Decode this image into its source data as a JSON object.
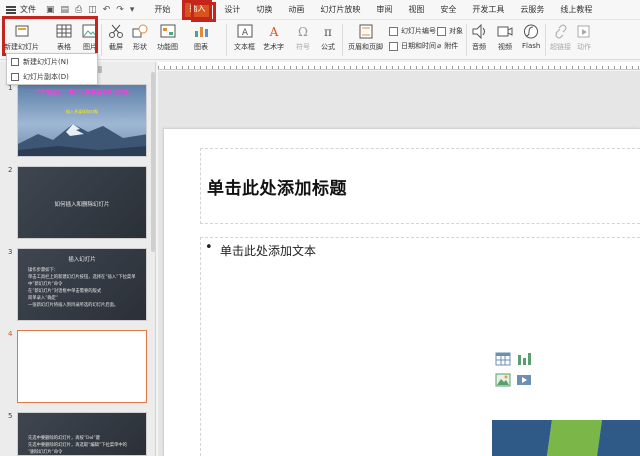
{
  "menubar": {
    "file_label": "文件",
    "menus": [
      "开始",
      "插入",
      "设计",
      "切换",
      "动画",
      "幻灯片放映",
      "审阅",
      "视图",
      "安全",
      "开发工具",
      "云服务",
      "线上教程"
    ],
    "active_menu": "插入"
  },
  "ribbon": {
    "new_slide": "新建幻灯片",
    "table": "表格",
    "picture": "图片",
    "screenshot": "截屏",
    "shape": "形状",
    "function_chart": "功能图",
    "chart": "图表",
    "textbox": "文本框",
    "wordart": "艺术字",
    "symbol": "符号",
    "formula": "公式",
    "header_footer": "页眉和页脚",
    "slide_number": "幻灯片编号",
    "date_time": "日期和时间",
    "object": "对象",
    "attachment": "附件",
    "audio": "音频",
    "video": "视频",
    "flash": "Flash",
    "hyperlink": "超链接",
    "action": "动作"
  },
  "dropdown": {
    "items": [
      "新建幻灯片(N)",
      "幻灯片副本(D)"
    ]
  },
  "thumbnails": {
    "slide1_title": "汽车制造行一事业天赛事活动转化比赔",
    "slide1_sub": "插入多媒体和对象",
    "slide2_title": "如何插入和删除幻灯片",
    "slide3_title": "插入幻灯片",
    "slide3_lines": [
      "操作步骤如下：",
      "单击工具栏上的新建幻灯片按钮，选择在“插入”下拉菜单",
      "中“新幻灯片”命令",
      "在“新幻灯片”对话框中单击需要的版式",
      "简单录入“确定”",
      "一张新幻灯片将插入到目录所选的幻灯片后面。"
    ],
    "slide5_lines": [
      "先选中要删除的幻灯片，再按“Del”键",
      "先选中要删除的幻灯片，再选取“编辑”下拉菜单中的",
      "“删除幻灯片”命令"
    ],
    "numbers": [
      "1",
      "2",
      "3",
      "4",
      "5"
    ]
  },
  "slide": {
    "title_placeholder": "单击此处添加标题",
    "bullet": "•",
    "body_placeholder": "单击此处添加文本"
  },
  "colors": {
    "accent": "#d9531e",
    "highlight": "#c4261d"
  }
}
